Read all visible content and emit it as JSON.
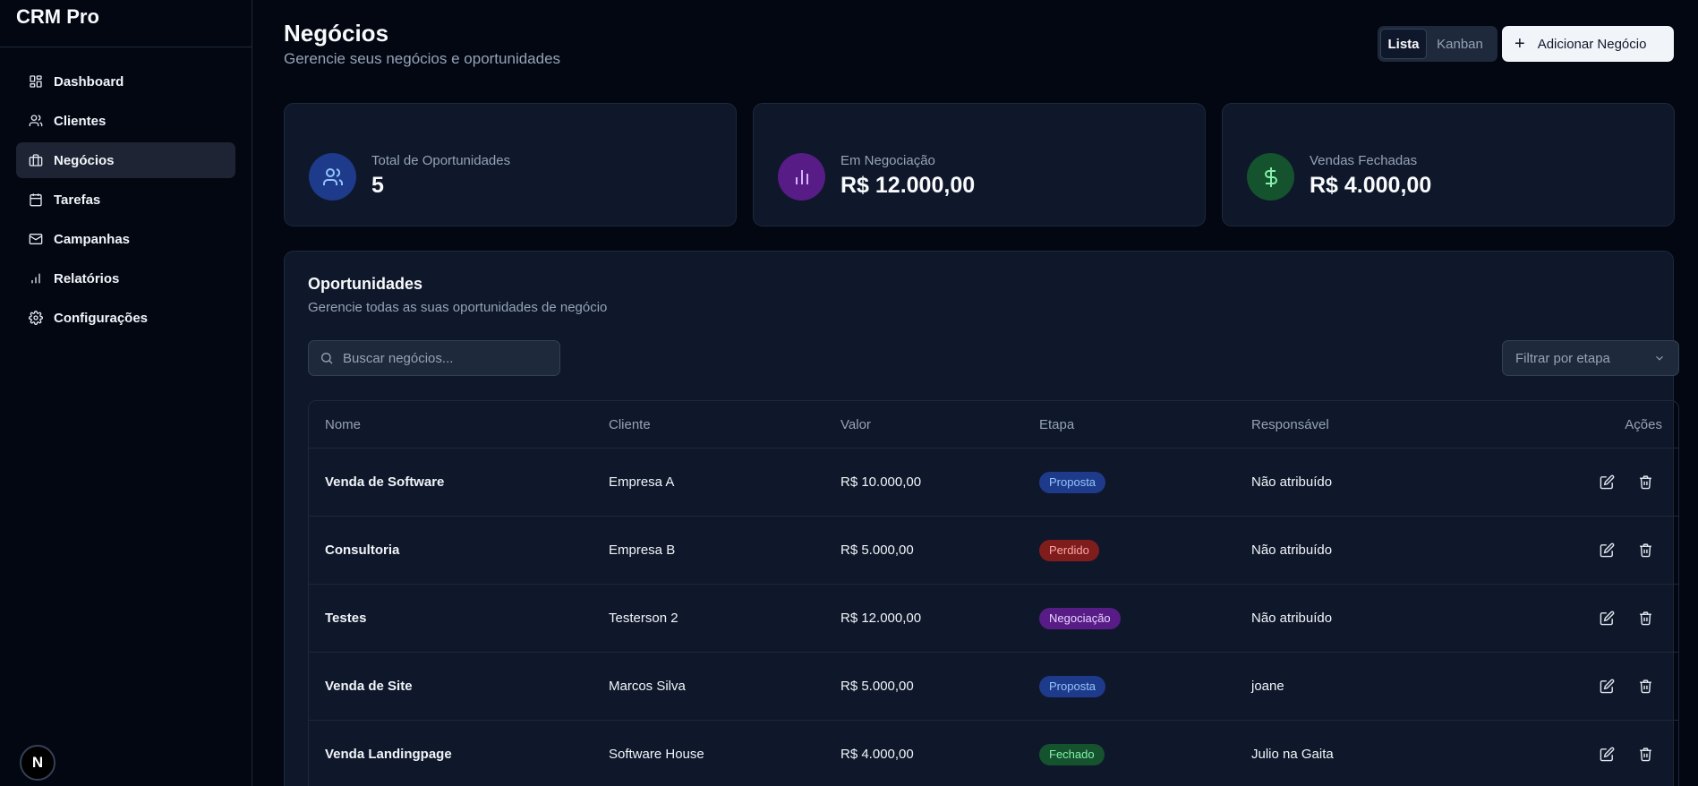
{
  "app": {
    "title": "CRM Pro"
  },
  "sidebar": {
    "items": [
      {
        "label": "Dashboard",
        "icon": "dashboard-icon"
      },
      {
        "label": "Clientes",
        "icon": "users-icon"
      },
      {
        "label": "Negócios",
        "icon": "briefcase-icon",
        "active": true
      },
      {
        "label": "Tarefas",
        "icon": "calendar-icon"
      },
      {
        "label": "Campanhas",
        "icon": "mail-icon"
      },
      {
        "label": "Relatórios",
        "icon": "bar-chart-icon"
      },
      {
        "label": "Configurações",
        "icon": "gear-icon"
      }
    ],
    "avatar_letter": "N"
  },
  "header": {
    "title": "Negócios",
    "subtitle": "Gerencie seus negócios e oportunidades",
    "view_list": "Lista",
    "view_kanban": "Kanban",
    "add_button": "Adicionar Negócio"
  },
  "stats": [
    {
      "label": "Total de Oportunidades",
      "value": "5",
      "icon": "users-icon",
      "color": "#1e3a8a",
      "icon_color": "#93c5fd"
    },
    {
      "label": "Em Negociação",
      "value": "R$ 12.000,00",
      "icon": "bar-chart-icon",
      "color": "#581c87",
      "icon_color": "#d8b4fe"
    },
    {
      "label": "Vendas Fechadas",
      "value": "R$ 4.000,00",
      "icon": "dollar-icon",
      "color": "#14532d",
      "icon_color": "#86efac"
    }
  ],
  "panel": {
    "title": "Oportunidades",
    "subtitle": "Gerencie todas as suas oportunidades de negócio",
    "search_placeholder": "Buscar negócios...",
    "filter_placeholder": "Filtrar por etapa"
  },
  "table": {
    "columns": [
      "Nome",
      "Cliente",
      "Valor",
      "Etapa",
      "Responsável",
      "Ações"
    ],
    "rows": [
      {
        "nome": "Venda de Software",
        "cliente": "Empresa A",
        "valor": "R$ 10.000,00",
        "etapa": "Proposta",
        "responsavel": "Não atribuído"
      },
      {
        "nome": "Consultoria",
        "cliente": "Empresa B",
        "valor": "R$ 5.000,00",
        "etapa": "Perdido",
        "responsavel": "Não atribuído"
      },
      {
        "nome": "Testes",
        "cliente": "Testerson 2",
        "valor": "R$ 12.000,00",
        "etapa": "Negociação",
        "responsavel": "Não atribuído"
      },
      {
        "nome": "Venda de Site",
        "cliente": "Marcos Silva",
        "valor": "R$ 5.000,00",
        "etapa": "Proposta",
        "responsavel": "joane"
      },
      {
        "nome": "Venda Landingpage",
        "cliente": "Software House",
        "valor": "R$ 4.000,00",
        "etapa": "Fechado",
        "responsavel": "Julio na Gaita"
      }
    ]
  },
  "stage_colors": {
    "Proposta": {
      "bg": "#1e3a8a",
      "fg": "#93c5fd"
    },
    "Perdido": {
      "bg": "#7f1d1d",
      "fg": "#fca5a5"
    },
    "Negociação": {
      "bg": "#581c87",
      "fg": "#e9d5ff"
    },
    "Fechado": {
      "bg": "#14532d",
      "fg": "#86efac"
    }
  }
}
